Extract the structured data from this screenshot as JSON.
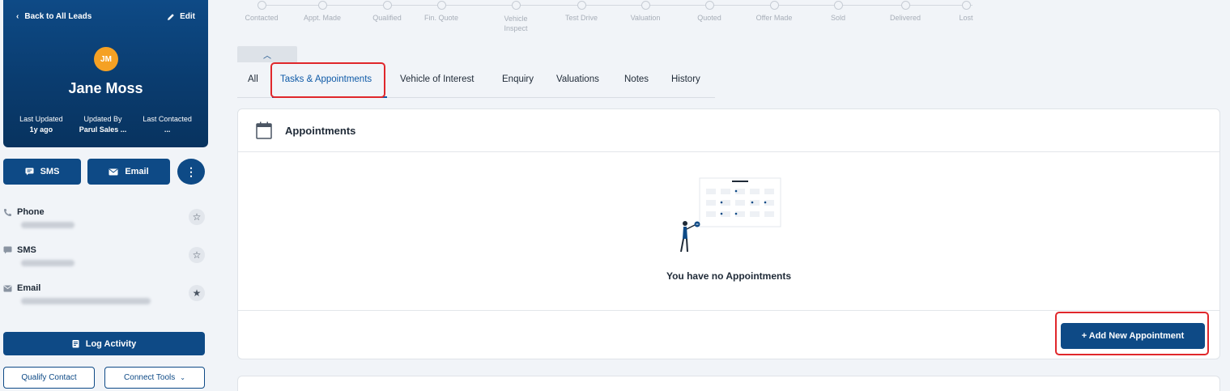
{
  "sidebar": {
    "back_label": "Back to All Leads",
    "edit_label": "Edit",
    "avatar_initials": "JM",
    "avatar_color": "#f5a124",
    "name": "Jane Moss",
    "meta": [
      {
        "label": "Last Updated",
        "value": "1y ago"
      },
      {
        "label": "Updated By",
        "value": "Parul Sales ..."
      },
      {
        "label": "Last Contacted",
        "value": "..."
      }
    ],
    "sms_button": "SMS",
    "email_button": "Email",
    "more_button": "⋮",
    "contacts": [
      {
        "label": "Phone",
        "icon": "phone-icon",
        "favorite": false
      },
      {
        "label": "SMS",
        "icon": "sms-icon",
        "favorite": false
      },
      {
        "label": "Email",
        "icon": "email-icon",
        "favorite": true
      }
    ],
    "log_activity": "Log Activity",
    "qualify_contact": "Qualify Contact",
    "connect_tools": "Connect Tools"
  },
  "stages": [
    "Contacted",
    "Appt. Made",
    "Qualified",
    "Fin. Quote",
    "Vehicle Inspect",
    "Test Drive",
    "Valuation",
    "Quoted",
    "Offer Made",
    "Sold",
    "Delivered",
    "Lost"
  ],
  "tabs": [
    "All",
    "Tasks & Appointments",
    "Vehicle of Interest",
    "Enquiry",
    "Valuations",
    "Notes",
    "History"
  ],
  "active_tab": "Tasks & Appointments",
  "appointments": {
    "title": "Appointments",
    "empty_message": "You have no Appointments",
    "add_button": "+ Add New Appointment"
  },
  "colors": {
    "primary": "#0e4a86",
    "accent_link": "#0e5aa7",
    "highlight": "#e0272b"
  }
}
